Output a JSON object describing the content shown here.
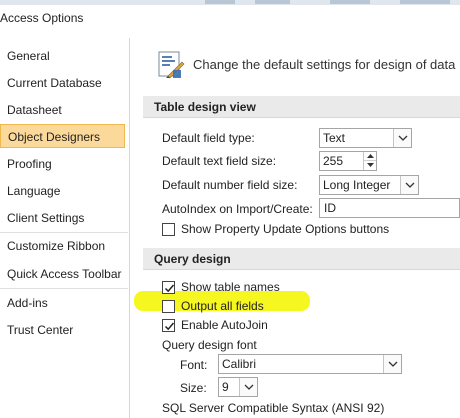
{
  "window": {
    "title": "Access Options"
  },
  "nav": {
    "items": [
      {
        "label": "General",
        "selected": false
      },
      {
        "label": "Current Database",
        "selected": false
      },
      {
        "label": "Datasheet",
        "selected": false
      },
      {
        "label": "Object Designers",
        "selected": true
      },
      {
        "label": "Proofing",
        "selected": false
      },
      {
        "label": "Language",
        "selected": false
      },
      {
        "label": "Client Settings",
        "selected": false
      },
      {
        "label": "Customize Ribbon",
        "selected": false
      },
      {
        "label": "Quick Access Toolbar",
        "selected": false
      },
      {
        "label": "Add-ins",
        "selected": false
      },
      {
        "label": "Trust Center",
        "selected": false
      }
    ]
  },
  "header": {
    "text": "Change the default settings for design of data",
    "icon": "design-settings-icon"
  },
  "table_design": {
    "heading": "Table design view",
    "field_type_label": "Default field type:",
    "field_type_value": "Text",
    "text_size_label": "Default text field size:",
    "text_size_value": "255",
    "number_size_label": "Default number field size:",
    "number_size_value": "Long Integer",
    "autoindex_label": "AutoIndex on Import/Create:",
    "autoindex_value": "ID",
    "show_property_label": "Show Property Update Options buttons",
    "show_property_checked": false
  },
  "query_design": {
    "heading": "Query design",
    "show_table_names_label": "Show table names",
    "show_table_names_checked": true,
    "output_all_fields_label": "Output all fields",
    "output_all_fields_checked": false,
    "enable_autojoin_label": "Enable AutoJoin",
    "enable_autojoin_checked": true,
    "font_heading": "Query design font",
    "font_label": "Font:",
    "font_value": "Calibri",
    "size_label": "Size:",
    "size_value": "9",
    "sql_label": "SQL Server Compatible Syntax (ANSI 92)"
  },
  "colors": {
    "selected_nav_bg": "#fbd99b",
    "highlight": "#f6f614",
    "section_bg": "#eaeaea"
  }
}
